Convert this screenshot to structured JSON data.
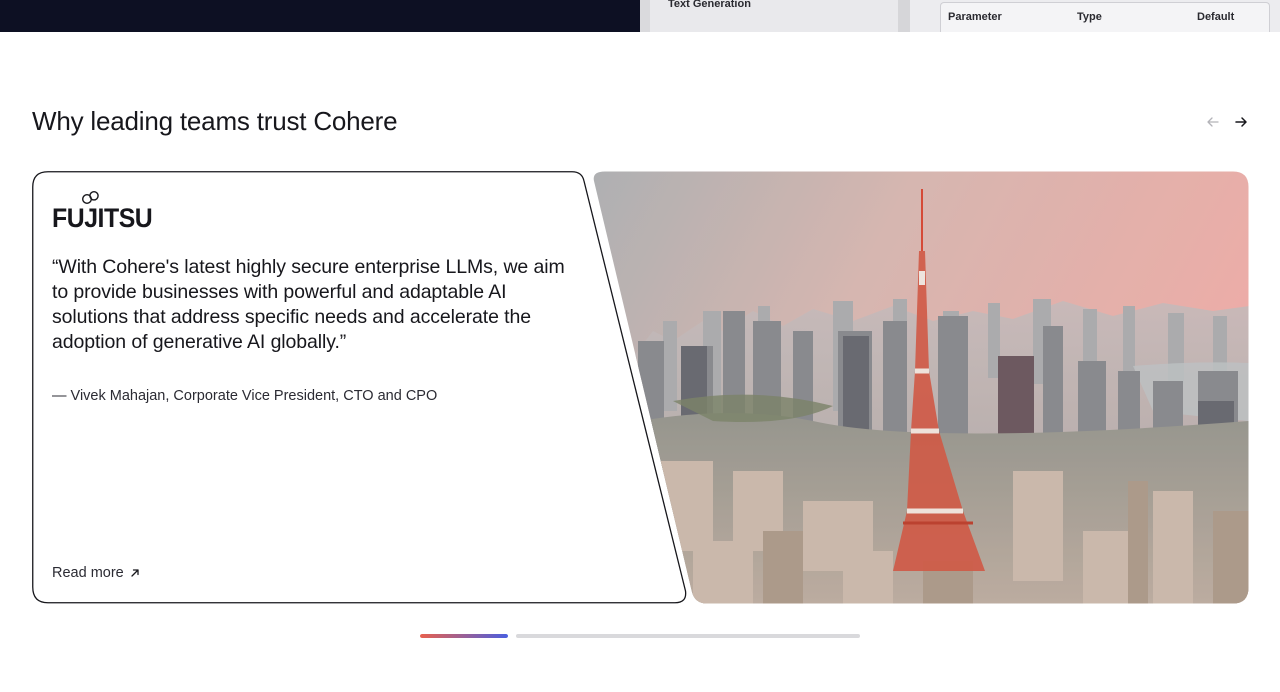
{
  "top_strip": {
    "panel_a_label": "Text Generation",
    "table_columns": [
      "Parameter",
      "Type",
      "Default"
    ]
  },
  "section": {
    "title": "Why leading teams trust Cohere"
  },
  "testimonial": {
    "company_logo": "FUJITSU",
    "quote": "“With Cohere's latest highly secure enterprise LLMs, we aim to provide businesses with powerful and adaptable AI solutions that address specific needs and accelerate the adoption of generative AI globally.”",
    "attribution": "— Vivek Mahajan, Corporate Vice President, CTO and CPO",
    "read_more_label": "Read more",
    "read_more_icon": "arrow-up-right-icon",
    "image_alt": "Tokyo Tower and city skyline"
  },
  "carousel": {
    "prev_icon": "arrow-left-icon",
    "next_icon": "arrow-right-icon",
    "slide_count": 2,
    "active_index": 0
  },
  "colors": {
    "text": "#17171c",
    "progress_start": "#e8604e",
    "progress_end": "#4a5fe0",
    "progress_track": "#d9d9dc",
    "tower_red": "#d53a24"
  }
}
